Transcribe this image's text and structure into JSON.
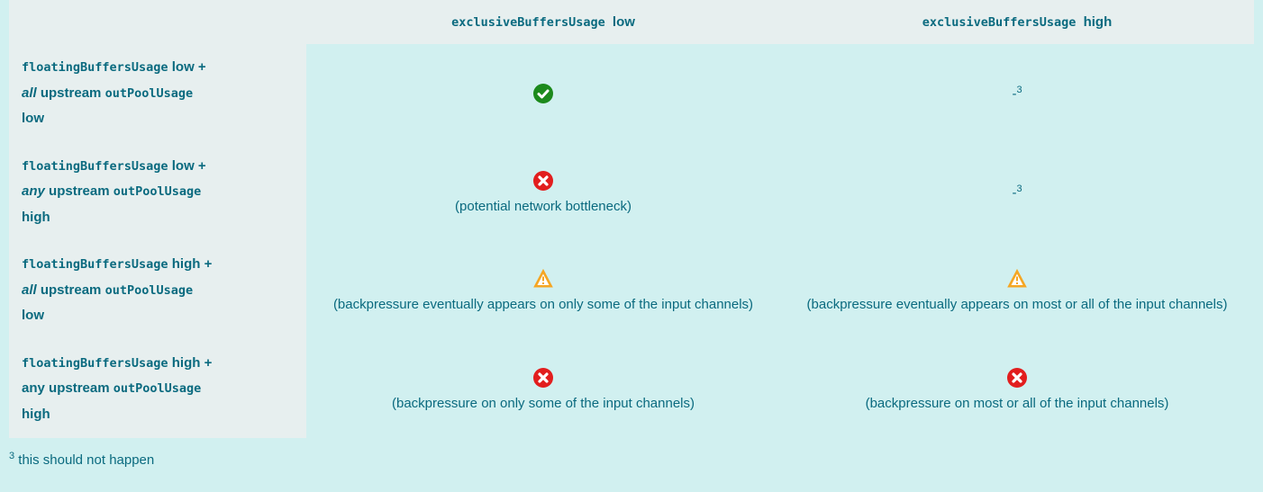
{
  "table": {
    "columns": [
      {
        "metric": "exclusiveBuffersUsage",
        "level": "low"
      },
      {
        "metric": "exclusiveBuffersUsage",
        "level": "high"
      }
    ],
    "rows": [
      {
        "metric1": "floatingBuffersUsage",
        "level1": "low",
        "plus": "+",
        "qualifier": "all",
        "upstreamWord": "upstream",
        "metric2": "outPoolUsage",
        "level2": "low",
        "cells": [
          {
            "icon": "check",
            "caption": ""
          },
          {
            "icon": "none",
            "dash": "-",
            "superscript": "3"
          }
        ]
      },
      {
        "metric1": "floatingBuffersUsage",
        "level1": "low",
        "plus": "+",
        "qualifier": "any",
        "upstreamWord": "upstream",
        "metric2": "outPoolUsage",
        "level2": "high",
        "cells": [
          {
            "icon": "cross",
            "caption": "(potential network bottleneck)"
          },
          {
            "icon": "none",
            "dash": "-",
            "superscript": "3"
          }
        ]
      },
      {
        "metric1": "floatingBuffersUsage",
        "level1": "high",
        "plus": "+",
        "qualifier": "all",
        "upstreamWord": "upstream",
        "metric2": "outPoolUsage",
        "level2": "low",
        "cells": [
          {
            "icon": "warning",
            "caption": "(backpressure eventually appears on only some of the input channels)"
          },
          {
            "icon": "warning",
            "caption": "(backpressure eventually appears on most or all of the input channels)"
          }
        ]
      },
      {
        "metric1": "floatingBuffersUsage",
        "level1": "high",
        "plus": "+",
        "qualifier": "any",
        "upstreamWord": "upstream",
        "metric2": "outPoolUsage",
        "level2": "high",
        "cells": [
          {
            "icon": "cross",
            "caption": "(backpressure on only some of the input channels)"
          },
          {
            "icon": "cross",
            "caption": "(backpressure on most or all of the input channels)"
          }
        ]
      }
    ]
  },
  "footnote": {
    "marker": "3",
    "text": " this should not happen"
  }
}
